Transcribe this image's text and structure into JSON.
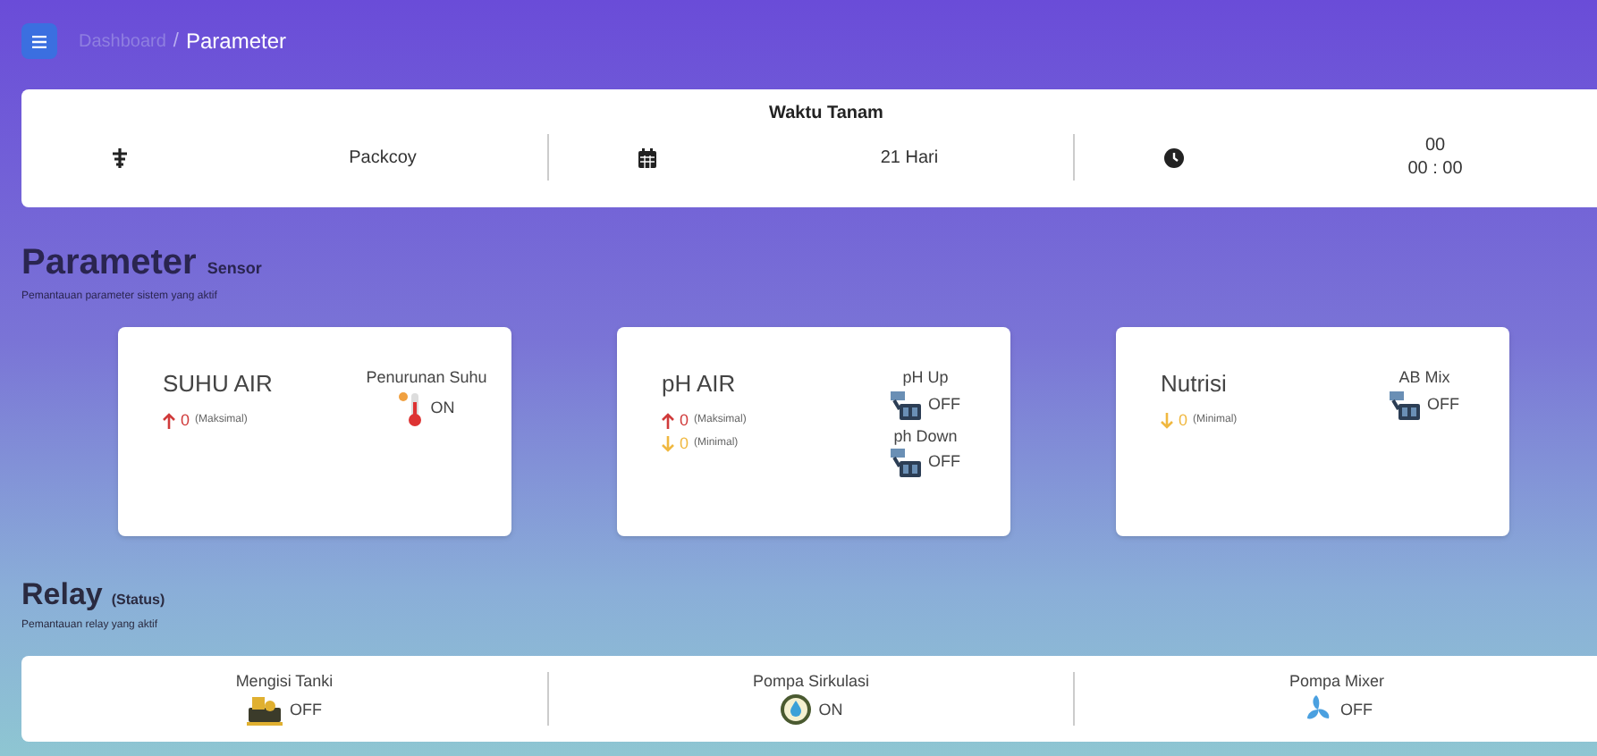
{
  "header": {
    "breadcrumb": [
      {
        "label": "Dashboard",
        "selected": false
      },
      {
        "label": "Parameter",
        "selected": true
      }
    ],
    "separator": "/"
  },
  "planting": {
    "title": "Waktu Tanam",
    "items": [
      {
        "kind": "plant",
        "lines": [
          "Packcoy"
        ]
      },
      {
        "kind": "calendar",
        "lines": [
          "21 Hari"
        ]
      },
      {
        "kind": "clock",
        "lines": [
          "00",
          "00 : 00"
        ]
      }
    ]
  },
  "sensor_section": {
    "title": "Parameter",
    "subtitle": "Sensor",
    "description": "Pemantauan parameter sistem yang aktif"
  },
  "sensors": [
    {
      "title": "SUHU AIR",
      "readings": [
        {
          "kind": "up",
          "value": "0",
          "label": "(Maksimal)"
        }
      ],
      "actuators": [
        {
          "name": "Penurunan Suhu",
          "kind": "thermometer",
          "status": "ON"
        }
      ]
    },
    {
      "title": "pH AIR",
      "readings": [
        {
          "kind": "up",
          "value": "0",
          "label": "(Maksimal)"
        },
        {
          "kind": "down",
          "value": "0",
          "label": "(Minimal)"
        }
      ],
      "actuators": [
        {
          "name": "pH Up",
          "kind": "doser",
          "status": "OFF"
        },
        {
          "name": "ph Down",
          "kind": "doser",
          "status": "OFF"
        }
      ]
    },
    {
      "title": "Nutrisi",
      "readings": [
        {
          "kind": "down",
          "value": "0",
          "label": "(Minimal)"
        }
      ],
      "actuators": [
        {
          "name": "AB Mix",
          "kind": "doser",
          "status": "OFF"
        }
      ]
    }
  ],
  "relay_section": {
    "title": "Relay",
    "subtitle": "(Status)",
    "description": "Pemantauan relay yang aktif"
  },
  "relays": [
    {
      "name": "Mengisi Tanki",
      "kind": "tank",
      "status": "OFF"
    },
    {
      "name": "Pompa Sirkulasi",
      "kind": "pump",
      "status": "ON"
    },
    {
      "name": "Pompa Mixer",
      "kind": "fan",
      "status": "OFF"
    }
  ]
}
